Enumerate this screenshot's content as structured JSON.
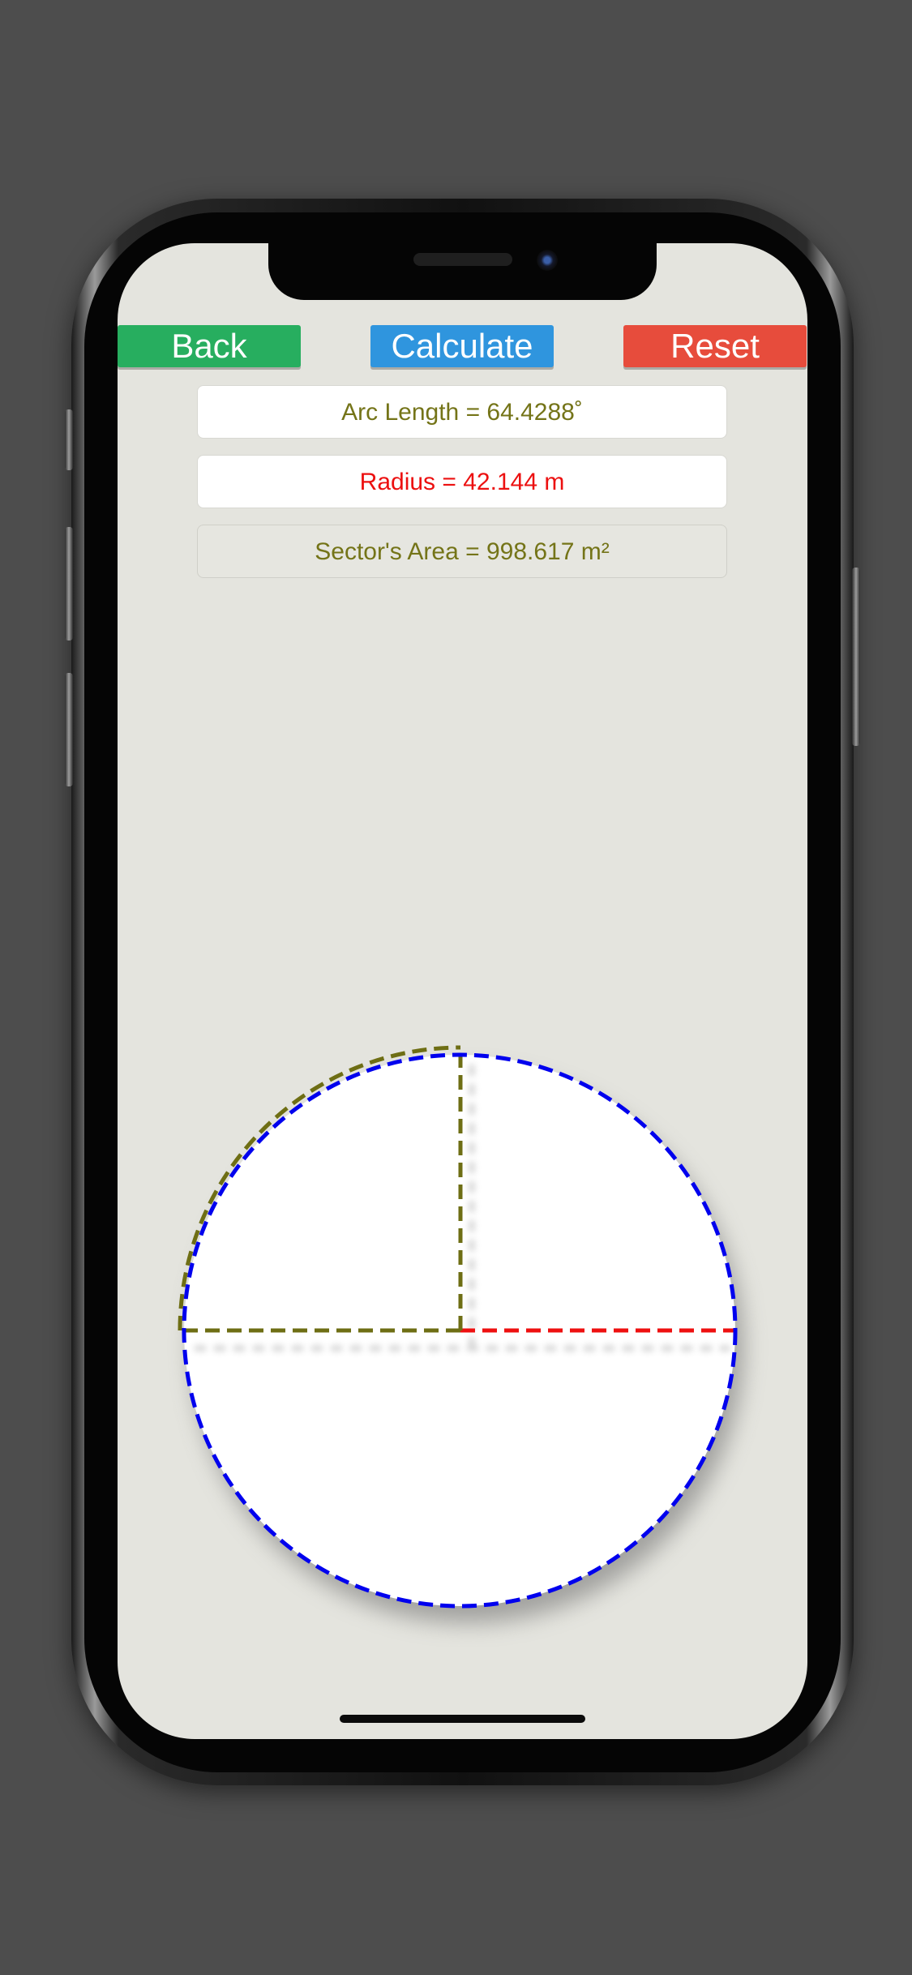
{
  "toolbar": {
    "back_label": "Back",
    "calculate_label": "Calculate",
    "reset_label": "Reset"
  },
  "results": {
    "arc_length": "Arc Length = 64.4288˚",
    "radius": "Radius = 42.144 m",
    "sector_area": "Sector's Area = 998.617 m²"
  },
  "colors": {
    "back": "#27ae5f",
    "calculate": "#2f95de",
    "reset": "#e74c3c",
    "olive_text": "#747418",
    "radius_text": "#ec1010",
    "circle_stroke": "#0000ee",
    "sector_stroke": "#6e6e14",
    "radius_stroke": "#ee1010"
  }
}
